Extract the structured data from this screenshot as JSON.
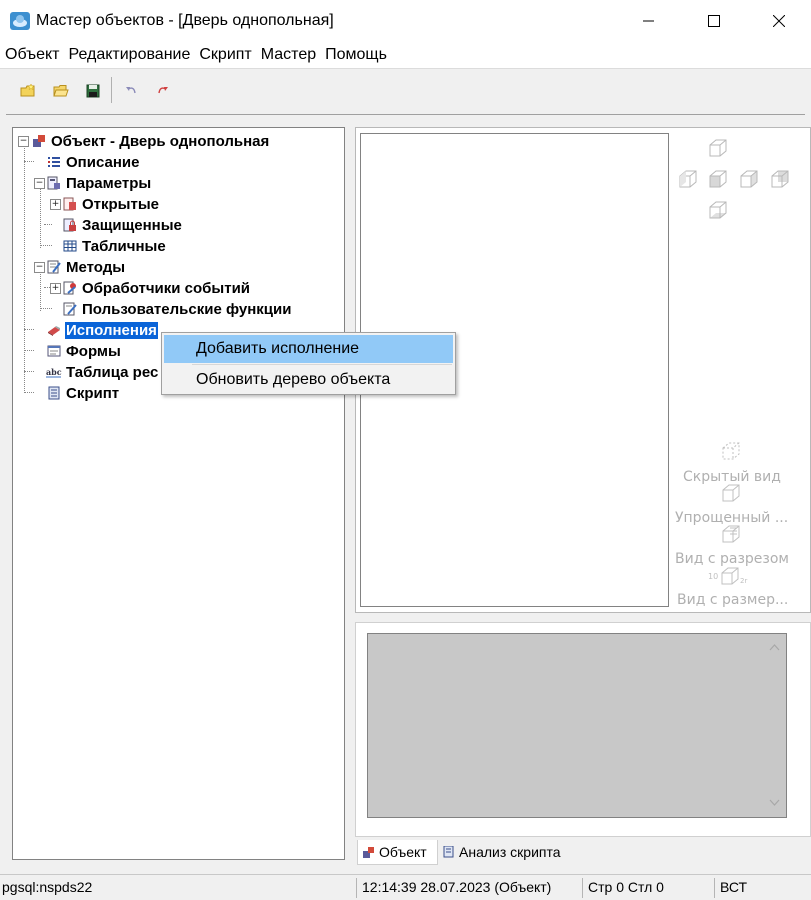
{
  "window": {
    "title": "Мастер объектов - [Дверь однопольная]"
  },
  "menubar": {
    "items": [
      "Объект",
      "Редактирование",
      "Скрипт",
      "Мастер",
      "Помощь"
    ]
  },
  "toolbar": {
    "icons": [
      "new-icon",
      "open-folder-icon",
      "save-icon",
      "undo-icon",
      "redo-icon"
    ]
  },
  "tree": {
    "root": "Объект - Дверь однопольная",
    "description": "Описание",
    "parameters": "Параметры",
    "open": "Открытые",
    "protected": "Защищенные",
    "tabular": "Табличные",
    "methods": "Методы",
    "event_handlers": "Обработчики событий",
    "user_functions": "Пользовательские функции",
    "variants": "Исполнения",
    "forms": "Формы",
    "resource_table": "Таблица рес",
    "script": "Скрипт"
  },
  "context_menu": {
    "items": [
      "Добавить исполнение",
      "Обновить дерево объекта"
    ]
  },
  "view_panel": {
    "hidden_view": "Скрытый вид",
    "simplified_view": "Упрощенный ...",
    "section_view": "Вид с разрезом",
    "dimension_view": "Вид с размер..."
  },
  "tabs": [
    "Объект",
    "Анализ скрипта"
  ],
  "status": {
    "connection": "pgsql:nspds22",
    "datetime": "12:14:39  28.07.2023  (Объект)",
    "position": "Стр 0 Стл 0",
    "mode": "ВСТ"
  },
  "colors": {
    "selection": "#0a64d8",
    "menu_highlight": "#91c9f7"
  }
}
